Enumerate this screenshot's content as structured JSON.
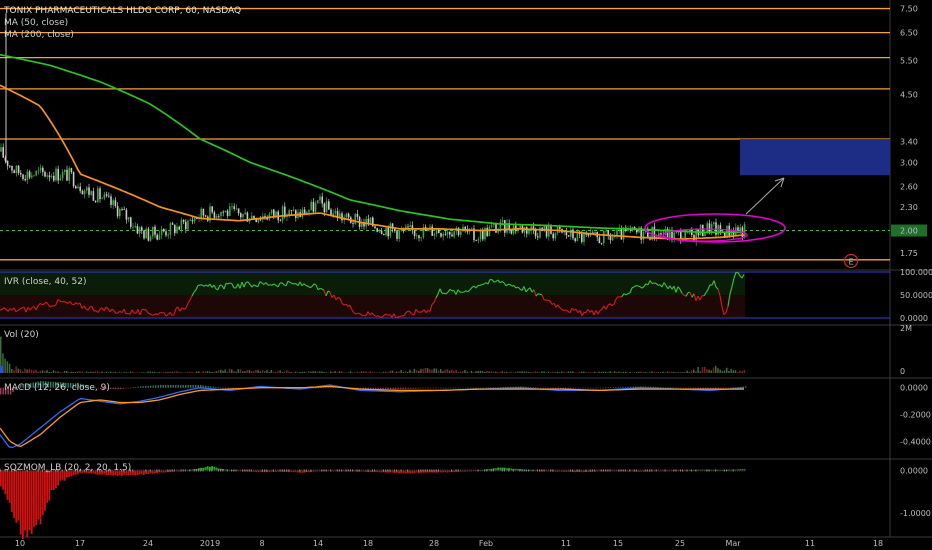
{
  "header": {
    "symbol_title": "TONIX PHARMACEUTICALS HLDG CORP, 60, NASDAQ",
    "ma50_label": "MA (50, close)",
    "ma200_label": "MA (200, close)"
  },
  "panes": {
    "ivr_label": "IVR (close, 40, 52)",
    "vol_label": "Vol (20)",
    "macd_label": "MACD (12, 26, close, 9)",
    "sqz_label": "SQZMOM_LB (20, 2, 20, 1.5)"
  },
  "earnings_marker": "E",
  "colors": {
    "background": "#000000",
    "ma50": "#f7931a",
    "ma200": "#29c41e",
    "hline": "#f5a13c",
    "current_price_line": "#2ecc40",
    "target_box": "#1f2f8c",
    "ellipse": "#e600d4",
    "candle_up": "#41a341",
    "candle_down": "#c9c9c9",
    "ivr_high": "#2d6e2d",
    "ivr_low": "#c61d1d",
    "macd_line": "#2a6df4",
    "signal_line": "#ff9a18",
    "sqz_neg": "#d11111",
    "sqz_pos": "#27b227"
  },
  "chart_data": [
    {
      "type": "line",
      "pane": "price",
      "x_ticks": [
        "10",
        "17",
        "24",
        "2019",
        "8",
        "14",
        "18",
        "28",
        "Feb",
        "11",
        "15",
        "25",
        "Mar",
        "11",
        "18"
      ],
      "y_ticks": [
        "7.50",
        "6.50",
        "5.50",
        "4.50",
        "3.40",
        "3.00",
        "2.60",
        "2.30",
        "2.00",
        "1.75"
      ],
      "scale": "log",
      "ylim": [
        1.6,
        7.8
      ],
      "current_price": "2.00",
      "horizontal_levels": [
        7.5,
        6.5,
        5.6,
        4.65,
        3.45,
        1.68
      ],
      "target_zone": {
        "from_price": 2.78,
        "to_price": 3.45
      },
      "series": [
        {
          "name": "MA (50, close)",
          "x": [
            0,
            40,
            80,
            120,
            160,
            200,
            240,
            280,
            320,
            360,
            400,
            440,
            480,
            520,
            560,
            600,
            640,
            680,
            720,
            745
          ],
          "values": [
            4.75,
            4.2,
            2.8,
            2.55,
            2.3,
            2.15,
            2.12,
            2.18,
            2.22,
            2.1,
            2.02,
            2.02,
            2.0,
            2.02,
            2.0,
            1.95,
            1.92,
            1.9,
            1.92,
            1.95
          ]
        },
        {
          "name": "MA (200, close)",
          "x": [
            0,
            50,
            100,
            150,
            200,
            250,
            300,
            350,
            400,
            450,
            500,
            550,
            600,
            650,
            700,
            745
          ],
          "values": [
            5.7,
            5.35,
            4.85,
            4.25,
            3.45,
            3.0,
            2.7,
            2.4,
            2.25,
            2.14,
            2.08,
            2.06,
            2.03,
            2.01,
            1.98,
            1.98
          ]
        },
        {
          "name": "price",
          "x": [
            0,
            6,
            15,
            30,
            50,
            70,
            85,
            100,
            120,
            140,
            148,
            160,
            180,
            200,
            220,
            240,
            260,
            280,
            300,
            320,
            330,
            345,
            370,
            400,
            430,
            460,
            475,
            490,
            510,
            530,
            560,
            590,
            610,
            630,
            650,
            670,
            690,
            710,
            720,
            735,
            745
          ],
          "values": [
            3.2,
            3.05,
            2.85,
            2.8,
            2.82,
            2.78,
            2.55,
            2.45,
            2.25,
            2.0,
            1.95,
            1.98,
            2.05,
            2.2,
            2.25,
            2.2,
            2.18,
            2.22,
            2.2,
            2.35,
            2.25,
            2.15,
            2.08,
            1.98,
            2.0,
            2.02,
            1.92,
            2.02,
            2.05,
            2.02,
            1.97,
            1.9,
            1.92,
            1.97,
            1.98,
            1.95,
            1.93,
            2.05,
            1.98,
            2.02,
            2.0
          ]
        }
      ]
    },
    {
      "type": "area",
      "pane": "ivr",
      "y_ticks": [
        "100.0000",
        "50.0000",
        "0.0000"
      ],
      "ylim": [
        0,
        100
      ],
      "series": [
        {
          "x": [
            0,
            30,
            60,
            100,
            140,
            170,
            185,
            195,
            230,
            270,
            310,
            330,
            345,
            360,
            400,
            430,
            440,
            460,
            480,
            500,
            530,
            560,
            580,
            600,
            620,
            650,
            680,
            700,
            715,
            725,
            735,
            745
          ],
          "values": [
            15,
            20,
            35,
            18,
            12,
            10,
            25,
            65,
            70,
            75,
            72,
            50,
            30,
            10,
            5,
            20,
            60,
            55,
            75,
            80,
            60,
            25,
            10,
            15,
            45,
            80,
            60,
            40,
            80,
            5,
            95,
            92
          ]
        }
      ]
    },
    {
      "type": "bar",
      "pane": "volume",
      "y_ticks": [
        "2M",
        "0"
      ],
      "ylim": [
        0,
        2
      ],
      "series": [
        {
          "x": [
            0,
            4,
            8,
            20,
            60,
            100,
            150,
            200,
            240,
            300,
            380,
            440,
            460,
            500,
            560,
            620,
            680,
            708,
            740
          ],
          "values": [
            1.3,
            0.8,
            0.4,
            0.15,
            0.08,
            0.05,
            0.05,
            0.06,
            0.16,
            0.07,
            0.05,
            0.2,
            0.1,
            0.06,
            0.05,
            0.06,
            0.05,
            0.3,
            0.12
          ]
        }
      ]
    },
    {
      "type": "line",
      "pane": "macd",
      "y_ticks": [
        "0.0000",
        "-0.2000",
        "-0.4000"
      ],
      "ylim": [
        -0.5,
        0.05
      ],
      "series": [
        {
          "name": "MACD",
          "x": [
            0,
            10,
            20,
            40,
            60,
            80,
            100,
            120,
            140,
            160,
            180,
            200,
            230,
            260,
            300,
            330,
            360,
            400,
            440,
            480,
            520,
            560,
            600,
            640,
            680,
            710,
            745
          ],
          "values": [
            -0.35,
            -0.45,
            -0.42,
            -0.3,
            -0.18,
            -0.08,
            -0.1,
            -0.12,
            -0.1,
            -0.07,
            -0.03,
            0.0,
            -0.02,
            0.01,
            -0.01,
            0.02,
            -0.02,
            -0.03,
            -0.02,
            -0.01,
            0.0,
            -0.02,
            -0.02,
            0.0,
            -0.01,
            -0.02,
            0.0
          ]
        },
        {
          "name": "Signal",
          "x": [
            0,
            10,
            20,
            40,
            60,
            80,
            100,
            120,
            140,
            160,
            180,
            200,
            230,
            260,
            300,
            330,
            360,
            400,
            440,
            480,
            520,
            560,
            600,
            640,
            680,
            710,
            745
          ],
          "values": [
            -0.3,
            -0.4,
            -0.44,
            -0.35,
            -0.22,
            -0.11,
            -0.09,
            -0.11,
            -0.11,
            -0.09,
            -0.05,
            -0.02,
            -0.01,
            0.0,
            0.0,
            0.01,
            -0.01,
            -0.02,
            -0.02,
            -0.01,
            -0.01,
            -0.01,
            -0.02,
            -0.01,
            -0.01,
            -0.01,
            -0.01
          ]
        }
      ]
    },
    {
      "type": "bar",
      "pane": "squeeze_momentum",
      "y_ticks": [
        "0.0000",
        "-1.0000"
      ],
      "ylim": [
        -1.5,
        0.2
      ],
      "series": [
        {
          "x": [
            0,
            10,
            20,
            30,
            40,
            50,
            60,
            80,
            100,
            120,
            140,
            160,
            180,
            200,
            210,
            220,
            240,
            260,
            280,
            300,
            320,
            340,
            360,
            380,
            400,
            440,
            470,
            500,
            520,
            540,
            560,
            580,
            600,
            620,
            640,
            660,
            680,
            700,
            720,
            740
          ],
          "values": [
            -0.4,
            -0.95,
            -1.45,
            -1.4,
            -1.1,
            -0.55,
            -0.25,
            -0.05,
            -0.1,
            -0.12,
            -0.1,
            -0.05,
            -0.02,
            0.06,
            0.1,
            0.04,
            -0.02,
            -0.04,
            -0.03,
            -0.05,
            -0.02,
            -0.02,
            -0.03,
            -0.04,
            -0.06,
            -0.05,
            -0.02,
            0.07,
            0.03,
            -0.02,
            -0.03,
            -0.04,
            -0.02,
            -0.02,
            -0.03,
            -0.02,
            -0.01,
            0.02,
            0.01,
            0.03
          ]
        }
      ]
    }
  ]
}
